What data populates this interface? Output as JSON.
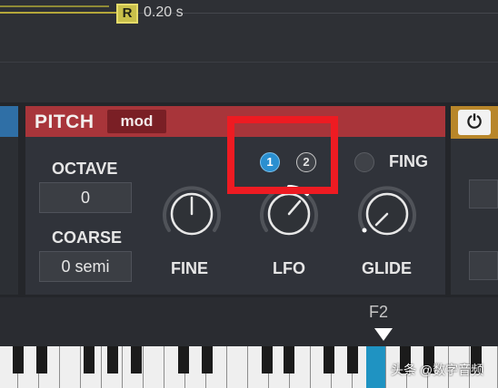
{
  "envelope": {
    "release_marker": "R",
    "release_time": "0.20 s"
  },
  "pitch": {
    "title": "PITCH",
    "mod_label": "mod",
    "octave": {
      "label": "OCTAVE",
      "value": "0"
    },
    "coarse": {
      "label": "COARSE",
      "value": "0 semi"
    },
    "fine": {
      "label": "FINE"
    },
    "lfo": {
      "label": "LFO",
      "btn1": "1",
      "btn2": "2"
    },
    "glide": {
      "label": "GLIDE"
    },
    "fing": {
      "label": "FING"
    }
  },
  "power": {
    "symbol": "⏻"
  },
  "keyboard": {
    "note_label": "F2"
  },
  "watermark": "头条 @数字音频",
  "colors": {
    "header": "#a8353a",
    "mod_button": "#7a1f25",
    "lfo_active": "#2a8fd0",
    "highlight": "#ee1b22",
    "active_key": "#1f93c2"
  }
}
